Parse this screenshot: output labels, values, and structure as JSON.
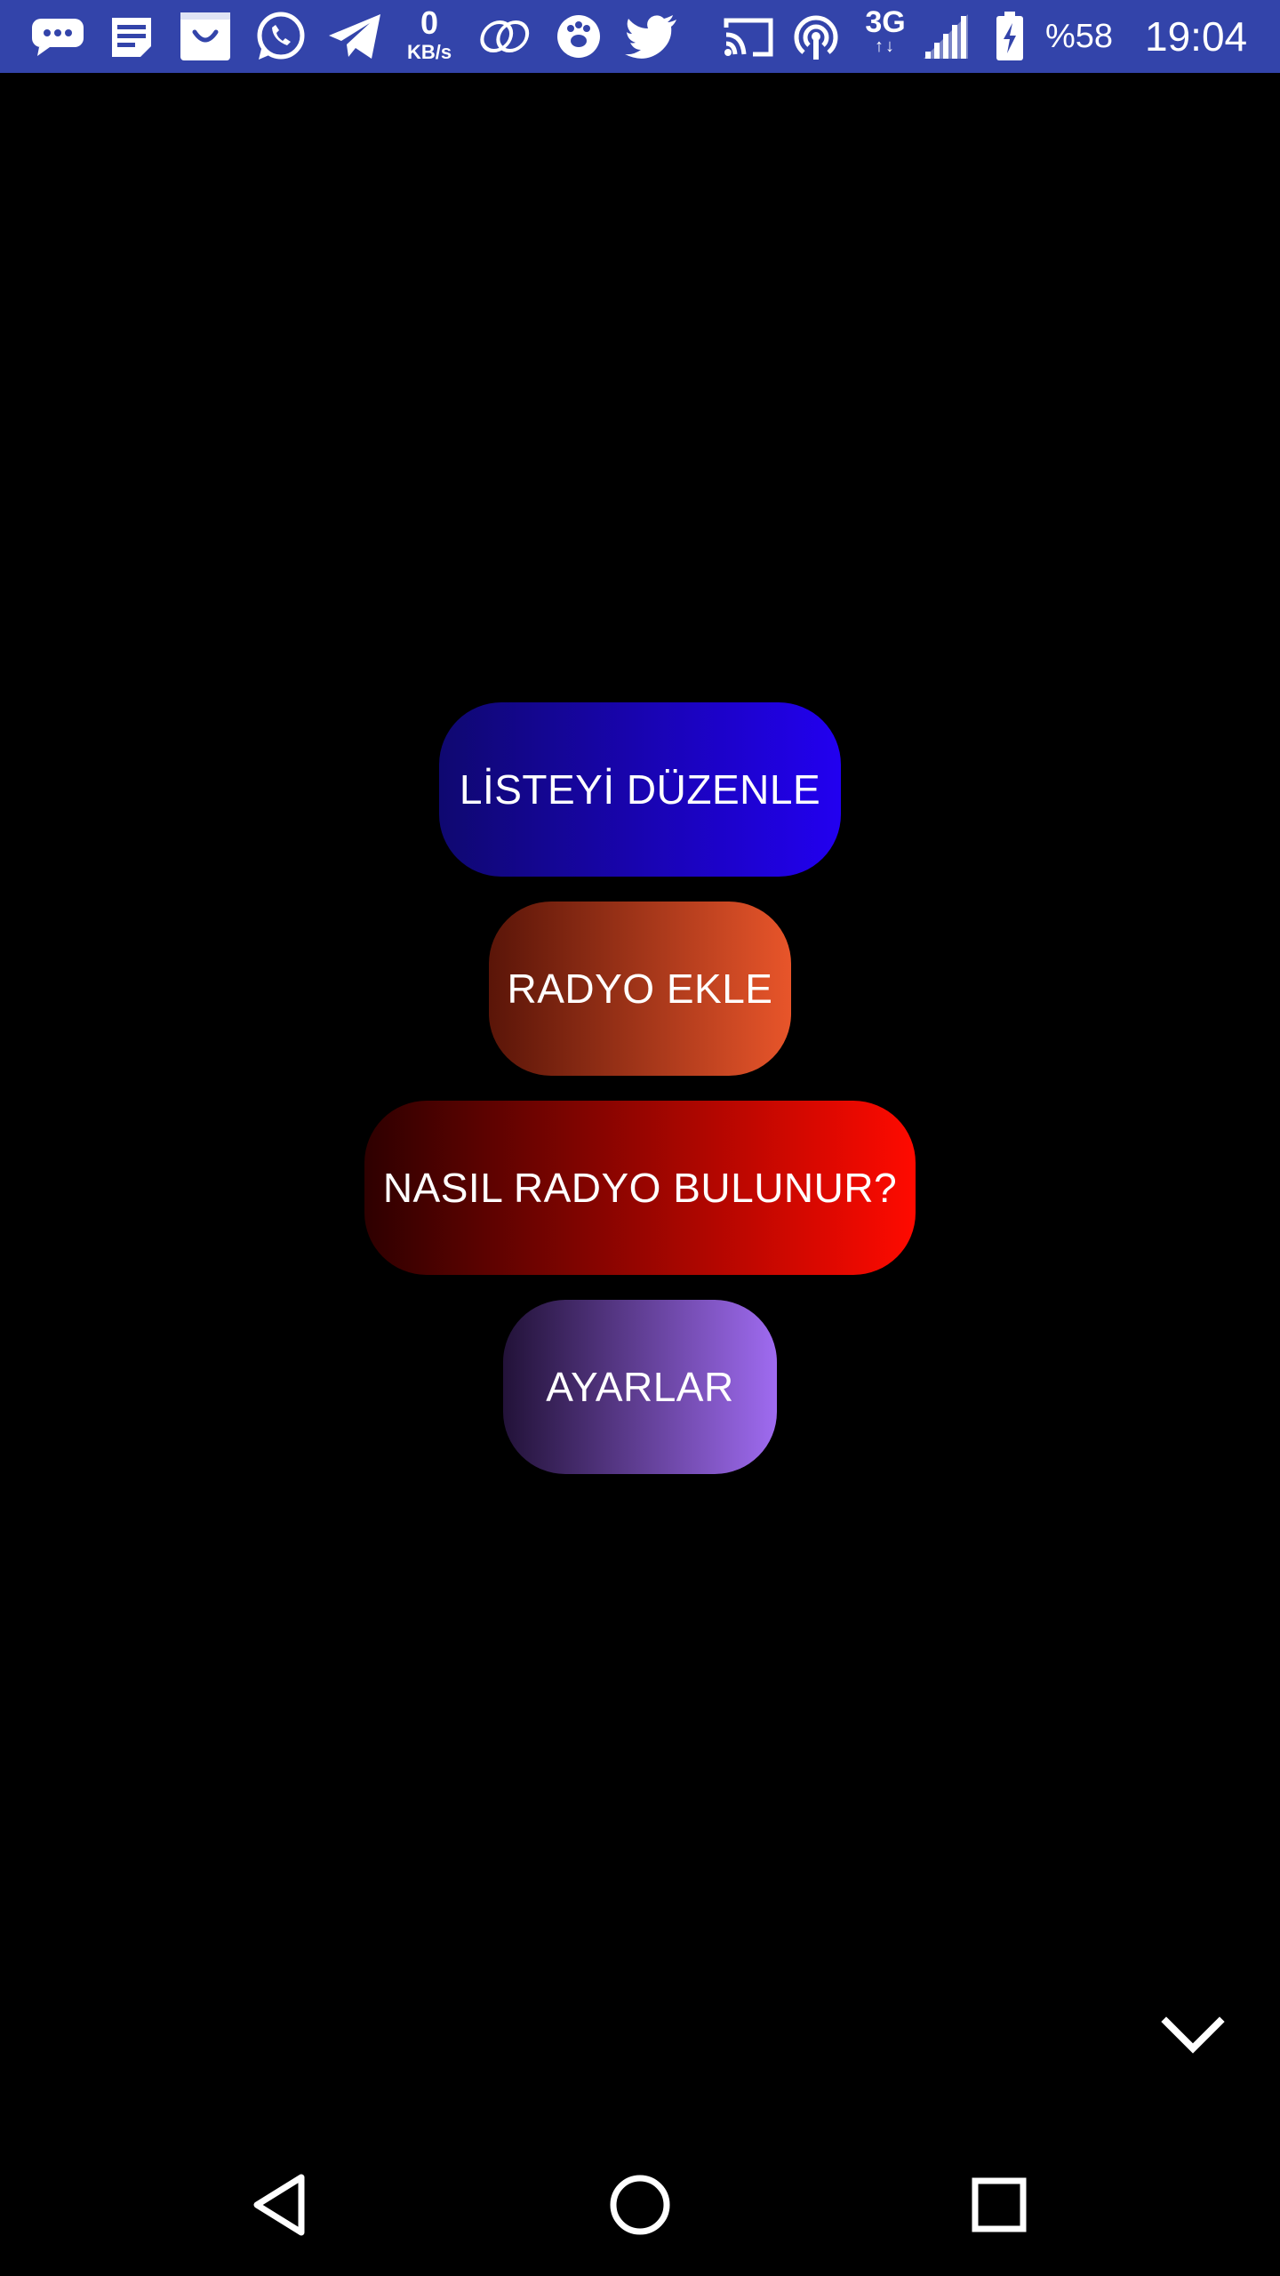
{
  "status_bar": {
    "background": "#3344aa",
    "icons_left": [
      "messages-icon",
      "notes-icon",
      "shopping-bag-icon",
      "whatsapp-icon",
      "telegram-icon"
    ],
    "data_speed_value": "0",
    "data_speed_unit": "KB/s",
    "icons_middle": [
      "link-icon",
      "pawprint-icon",
      "twitter-icon",
      "cast-icon",
      "hotspot-icon"
    ],
    "network_type": "3G",
    "network_arrows": "↑↓",
    "battery_percent": "%58",
    "time": "19:04"
  },
  "menu": {
    "buttons": [
      {
        "label": "LİSTEYİ DÜZENLE",
        "gradient": [
          "#0f0870",
          "#2200f0"
        ]
      },
      {
        "label": "RADYO EKLE",
        "gradient": [
          "#5a1508",
          "#e8552a"
        ]
      },
      {
        "label": "NASIL RADYO BULUNUR?",
        "gradient": [
          "#2e0000",
          "#ff0a00"
        ]
      },
      {
        "label": "AYARLAR",
        "gradient": [
          "#221238",
          "#9f6bf0"
        ]
      }
    ]
  },
  "collapse_icon": "chevron-down-icon",
  "nav_bar": {
    "buttons": [
      "back-icon",
      "home-icon",
      "recents-icon"
    ]
  }
}
